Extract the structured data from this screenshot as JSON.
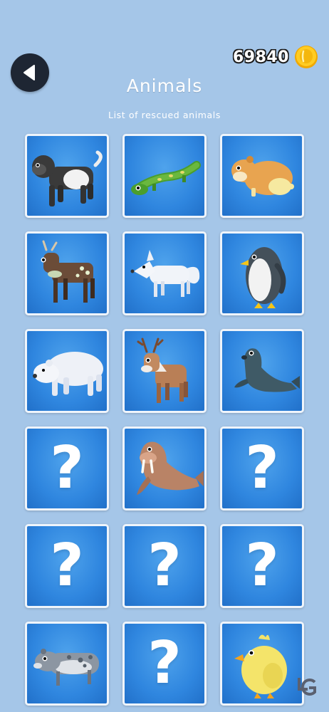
{
  "header": {
    "back_icon": "back-arrow-icon",
    "coin_count": "69840",
    "coin_icon": "gold-coin-icon",
    "title": "Animals",
    "subtitle": "List of rescued animals"
  },
  "grid": {
    "columns": 3,
    "tiles": [
      {
        "animal": "gorilla",
        "locked": false
      },
      {
        "animal": "green-lizard",
        "locked": false
      },
      {
        "animal": "hamster",
        "locked": false
      },
      {
        "animal": "spotted-deer",
        "locked": false
      },
      {
        "animal": "arctic-fox",
        "locked": false
      },
      {
        "animal": "penguin",
        "locked": false
      },
      {
        "animal": "polar-bear",
        "locked": false
      },
      {
        "animal": "reindeer",
        "locked": false
      },
      {
        "animal": "seal",
        "locked": false
      },
      {
        "animal": "unknown",
        "locked": true,
        "label": "?"
      },
      {
        "animal": "walrus",
        "locked": false
      },
      {
        "animal": "unknown",
        "locked": true,
        "label": "?"
      },
      {
        "animal": "unknown",
        "locked": true,
        "label": "?"
      },
      {
        "animal": "unknown",
        "locked": true,
        "label": "?"
      },
      {
        "animal": "unknown",
        "locked": true,
        "label": "?"
      },
      {
        "animal": "spotted-seal",
        "locked": false
      },
      {
        "animal": "unknown",
        "locked": true,
        "label": "?"
      },
      {
        "animal": "chick",
        "locked": false
      }
    ]
  },
  "colors": {
    "background": "#a5c6e8",
    "tile_blue": "#2f86df",
    "tile_border": "#eef4fb",
    "coin_gold": "#f5b60a"
  },
  "watermark": "4gamer-logo"
}
